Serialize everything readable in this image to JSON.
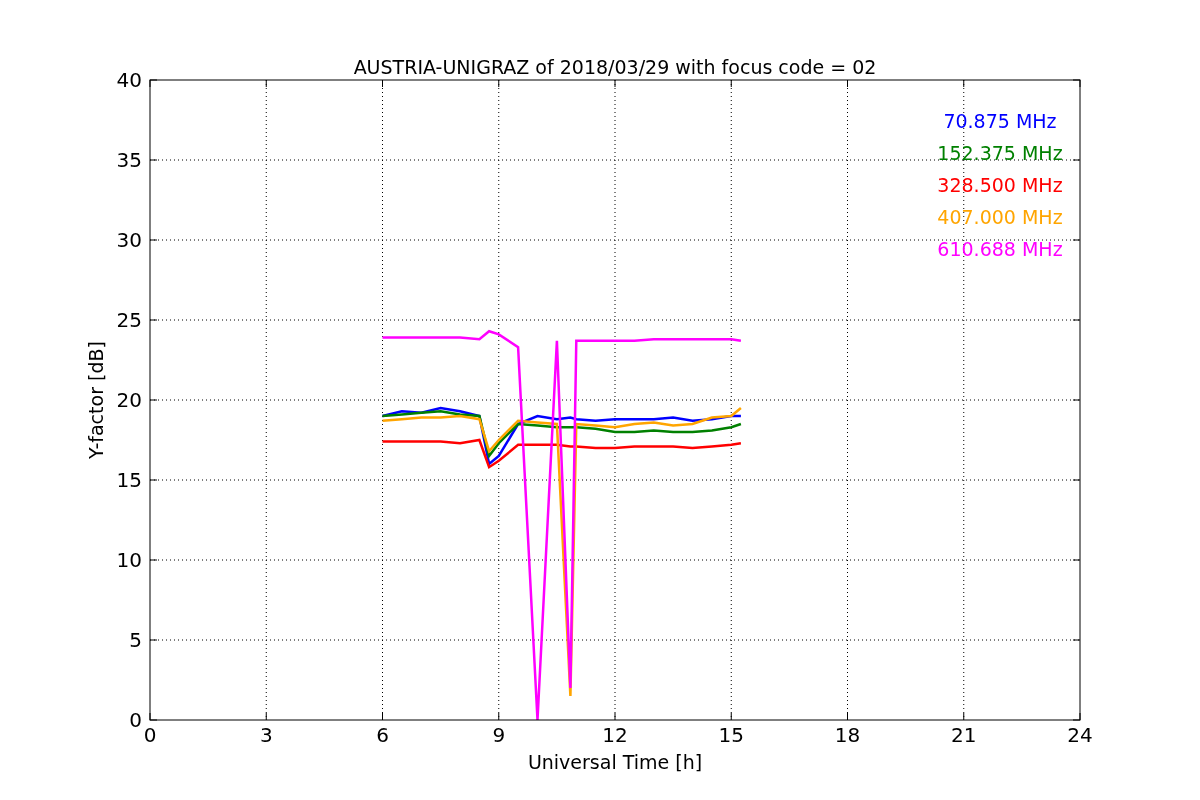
{
  "chart_data": {
    "type": "line",
    "title": "AUSTRIA-UNIGRAZ of 2018/03/29 with focus code = 02",
    "xlabel": "Universal Time [h]",
    "ylabel": "Y-factor [dB]",
    "x": [
      6,
      6.5,
      7,
      7.5,
      8,
      8.5,
      8.75,
      9,
      9.5,
      10,
      10.5,
      10.85,
      11,
      11.5,
      12,
      12.5,
      13,
      13.5,
      14,
      14.5,
      15,
      15.25
    ],
    "series": [
      {
        "name": "70.875 MHz",
        "color": "#0000ff",
        "values": [
          19,
          19.3,
          19.2,
          19.5,
          19.3,
          19,
          16,
          16.5,
          18.5,
          19,
          18.8,
          18.9,
          18.8,
          18.7,
          18.8,
          18.8,
          18.8,
          18.9,
          18.7,
          18.8,
          19,
          19
        ]
      },
      {
        "name": "152.375 MHz",
        "color": "#008000",
        "values": [
          19,
          19.1,
          19.2,
          19.3,
          19.1,
          19,
          16.5,
          17.3,
          18.5,
          18.4,
          18.3,
          18.3,
          18.3,
          18.2,
          18,
          18,
          18.1,
          18,
          18,
          18.1,
          18.3,
          18.5
        ]
      },
      {
        "name": "328.500 MHz",
        "color": "#ff0000",
        "values": [
          17.4,
          17.4,
          17.4,
          17.4,
          17.3,
          17.5,
          15.8,
          16.2,
          17.2,
          17.2,
          17.2,
          17.1,
          17.1,
          17,
          17,
          17.1,
          17.1,
          17.1,
          17,
          17.1,
          17.2,
          17.3
        ]
      },
      {
        "name": "407.000 MHz",
        "color": "#ffa500",
        "values": [
          18.7,
          18.8,
          18.9,
          18.9,
          19,
          18.8,
          16.8,
          17.5,
          18.7,
          18.6,
          18.5,
          1.5,
          18.5,
          18.4,
          18.3,
          18.5,
          18.6,
          18.4,
          18.5,
          18.9,
          19,
          19.5
        ]
      },
      {
        "name": "610.688 MHz",
        "color": "#ff00ff",
        "values": [
          23.9,
          23.9,
          23.9,
          23.9,
          23.9,
          23.8,
          24.3,
          24.1,
          23.3,
          0,
          23.7,
          2,
          23.7,
          23.7,
          23.7,
          23.7,
          23.8,
          23.8,
          23.8,
          23.8,
          23.8,
          23.7
        ]
      }
    ],
    "xlim": [
      0,
      24
    ],
    "ylim": [
      0,
      40
    ],
    "xticks": [
      0,
      3,
      6,
      9,
      12,
      15,
      18,
      21,
      24
    ],
    "yticks": [
      0,
      5,
      10,
      15,
      20,
      25,
      30,
      35,
      40
    ],
    "grid": true
  }
}
